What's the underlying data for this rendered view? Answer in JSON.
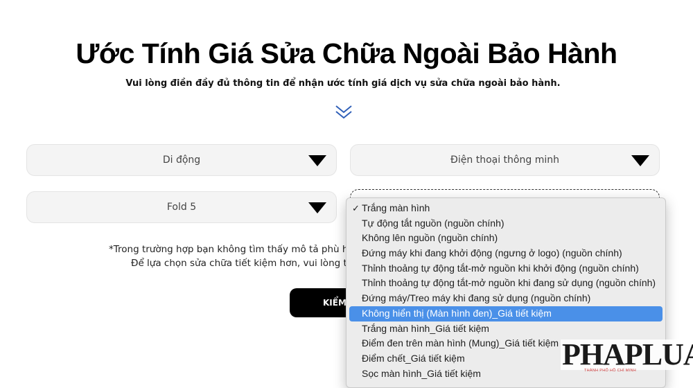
{
  "page": {
    "title": "Ước Tính Giá Sửa Chữa Ngoài Bảo Hành",
    "subtitle": "Vui lòng điền đầy đủ thông tin để nhận ước tính giá dịch vụ sửa chữa ngoài bảo hành."
  },
  "form": {
    "category": "Di động",
    "type": "Điện thoại thông minh",
    "model": "Fold 5",
    "note_line1": "*Trong trường hợp bạn không tìm thấy mô tả phù hợp, v",
    "note_line2": "Để lựa chọn sửa chữa tiết kiệm hơn, vui lòng tham",
    "check_button": "KIỂM"
  },
  "dropdown": {
    "checkmark": "✓",
    "highlight_color": "#4a90e8",
    "options": [
      "Trắng màn hình",
      "Tự động tắt nguồn (nguồn chính)",
      "Không lên nguồn (nguồn chính)",
      "Đứng máy khi đang khởi động (ngưng ở logo) (nguồn chính)",
      "Thỉnh thoảng tự động tắt-mở nguồn khi khởi động (nguồn chính)",
      "Thỉnh thoảng tự động tắt-mở nguồn khi đang sử dụng (nguồn chính)",
      "Đứng máy/Treo máy khi đang sử dụng (nguồn chính)",
      "Không hiển thị (Màn hình đen)_Giá tiết kiệm",
      "Trắng màn hình_Giá tiết kiệm",
      "Điểm đen trên màn hình (Mung)_Giá tiết kiệm",
      "Điểm chết_Giá tiết kiệm",
      "Sọc màn hình_Giá tiết kiệm"
    ],
    "checked_index": 0,
    "highlighted_index": 7
  },
  "watermark": {
    "text": "PHAPLUAT",
    "tagline": "THÀNH PHỐ HỒ CHÍ MINH"
  }
}
